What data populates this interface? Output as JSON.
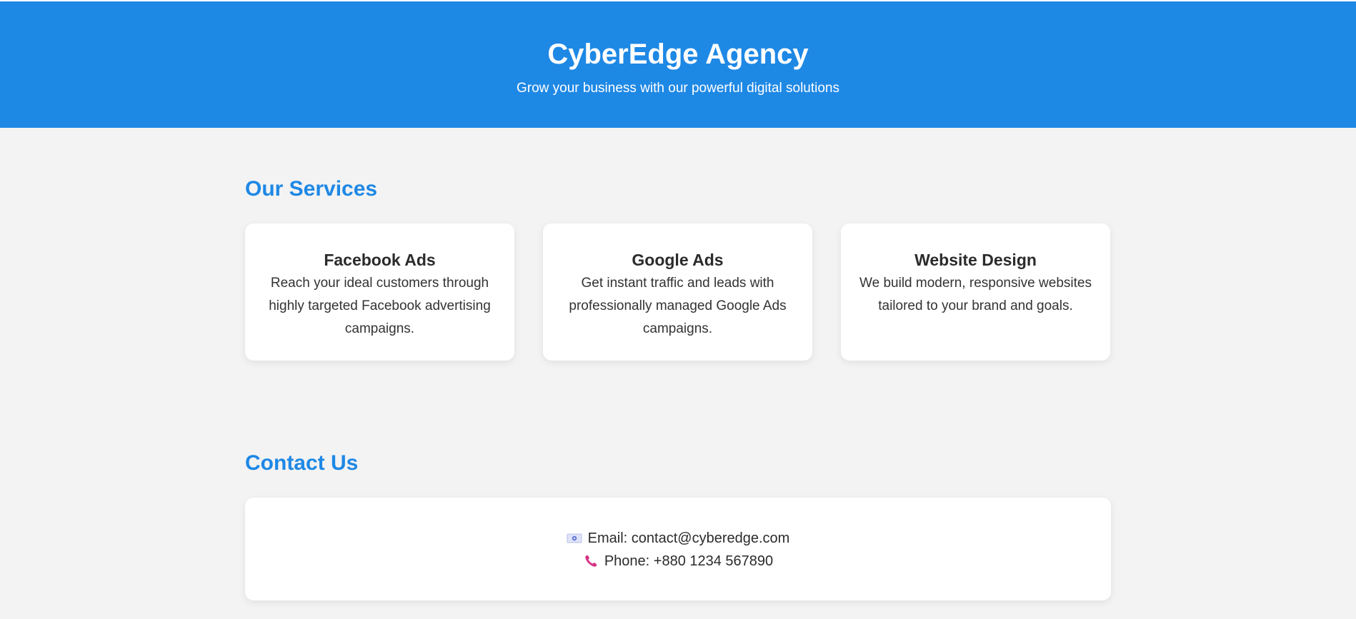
{
  "header": {
    "title": "CyberEdge Agency",
    "tagline": "Grow your business with our powerful digital solutions",
    "background_color": "#1e88e5"
  },
  "services": {
    "title": "Our Services",
    "items": [
      {
        "title": "Facebook Ads",
        "description": "Reach your ideal customers through highly targeted Facebook advertising campaigns."
      },
      {
        "title": "Google Ads",
        "description": "Get instant traffic and leads with professionally managed Google Ads campaigns."
      },
      {
        "title": "Website Design",
        "description": "We build modern, responsive websites tailored to your brand and goals."
      }
    ]
  },
  "contact": {
    "title": "Contact Us",
    "email": {
      "icon": "email-icon",
      "text": "Email: contact@cyberedge.com"
    },
    "phone": {
      "icon": "phone-icon",
      "text": "Phone: +880 1234 567890"
    }
  },
  "colors": {
    "accent": "#1e88e5",
    "page_background": "#f3f3f3",
    "card_background": "#ffffff"
  }
}
